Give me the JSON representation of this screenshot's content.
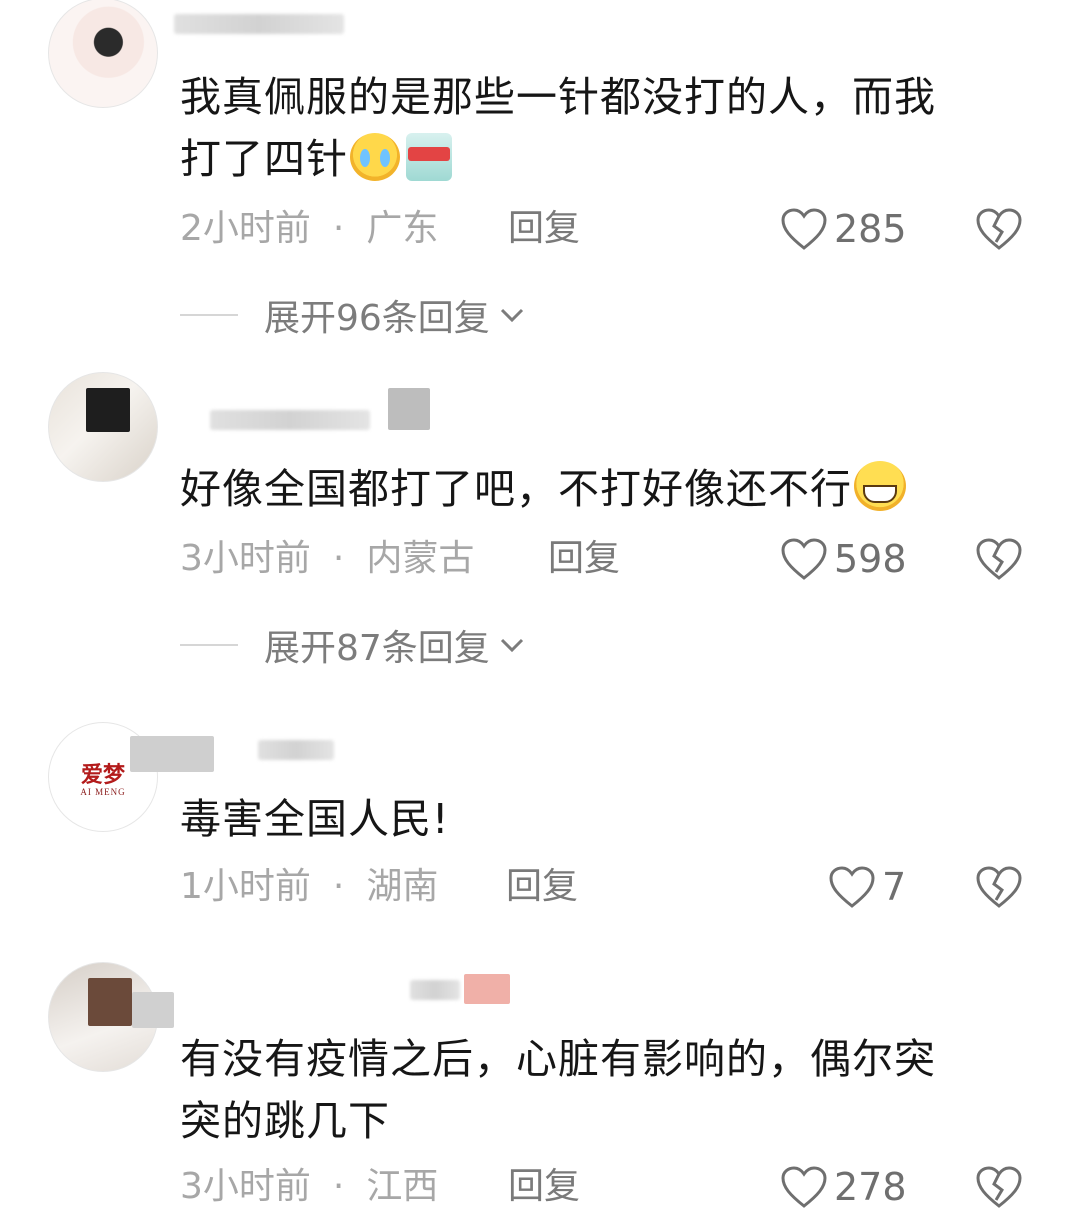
{
  "comments": [
    {
      "text_line1": "我真佩服的是那些一针都没打的人，而我",
      "text_line2": "打了四针",
      "emojis": [
        "crying-face-emoji",
        "detergent-pack-sticker"
      ],
      "time": "2小时前",
      "location": "广东",
      "reply_label": "回复",
      "likes": "285",
      "expand_label": "展开96条回复"
    },
    {
      "text_line1": "好像全国都打了吧，不打好像还不行",
      "emojis": [
        "grinning-face-emoji"
      ],
      "time": "3小时前",
      "location": "内蒙古",
      "reply_label": "回复",
      "likes": "598",
      "expand_label": "展开87条回复"
    },
    {
      "text_line1": "毒害全国人民!",
      "avatar_logo": "爱梦",
      "avatar_logo_sub": "AI MENG",
      "time": "1小时前",
      "location": "湖南",
      "reply_label": "回复",
      "likes": "7"
    },
    {
      "text_line1": "有没有疫情之后，心脏有影响的，偶尔突",
      "text_line2": "突的跳几下",
      "time": "3小时前",
      "location": "江西",
      "reply_label": "回复",
      "likes": "278"
    }
  ],
  "separator": "·",
  "icons": {
    "like": "heart-outline-icon",
    "dislike": "broken-heart-icon",
    "expand": "chevron-down-icon"
  },
  "colors": {
    "text": "#161616",
    "meta": "#a7a7a7",
    "action": "#7a7a7a"
  }
}
